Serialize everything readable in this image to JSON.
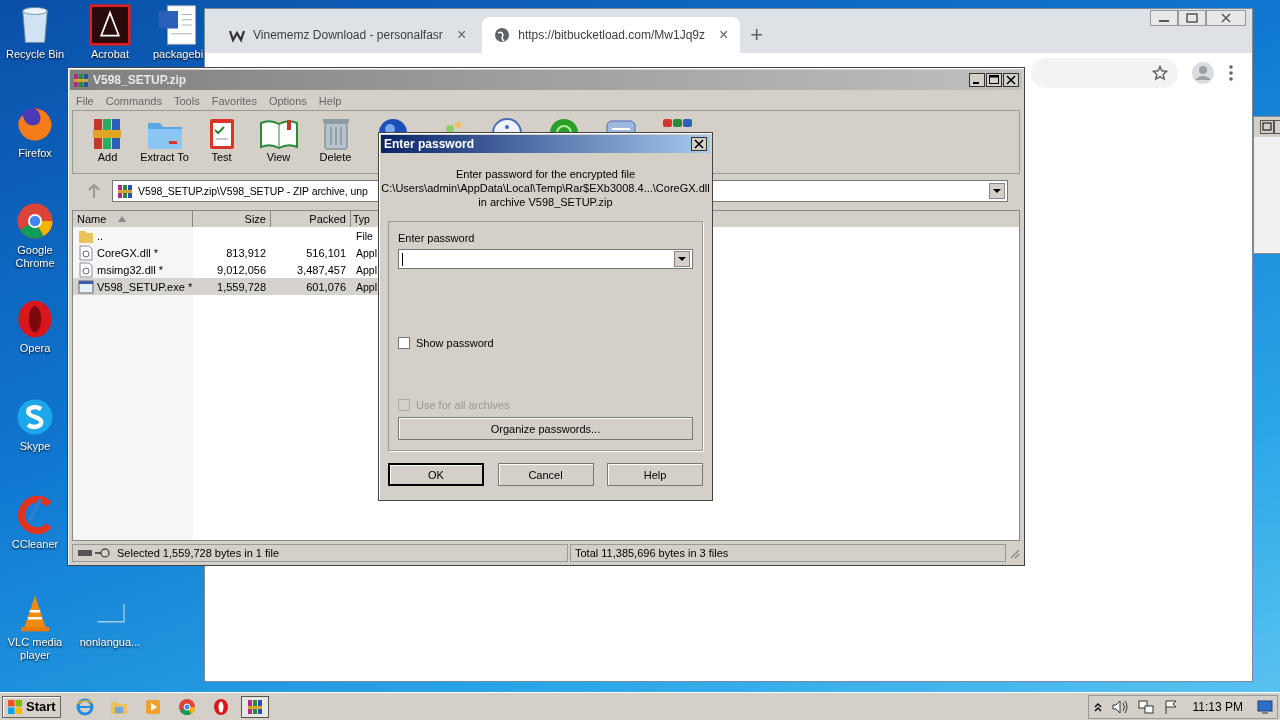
{
  "desktop_icons": [
    {
      "label": "Recycle Bin",
      "kind": "recycle"
    },
    {
      "label": "Acrobat",
      "kind": "acrobat"
    },
    {
      "label": "packagebi",
      "kind": "word"
    },
    {
      "label": "Firefox",
      "kind": "firefox"
    },
    {
      "label": "Google Chrome",
      "kind": "chrome"
    },
    {
      "label": "Opera",
      "kind": "opera"
    },
    {
      "label": "Skype",
      "kind": "skype"
    },
    {
      "label": "CCleaner",
      "kind": "ccleaner"
    },
    {
      "label": "VLC media player",
      "kind": "vlc"
    },
    {
      "label": "nonlangua...",
      "kind": "blank"
    }
  ],
  "browser": {
    "tabs": [
      {
        "title": "Vinememz Download - personalfasr",
        "kind": "site",
        "selected": false
      },
      {
        "title": "https://bitbucketload.com/Mw1Jq9z",
        "kind": "globe",
        "selected": true
      }
    ],
    "close_glyph": "×",
    "new_tab_glyph": "+"
  },
  "winrar": {
    "title": "V598_SETUP.zip",
    "menu": [
      "File",
      "Commands",
      "Tools",
      "Favorites",
      "Options",
      "Help"
    ],
    "toolbar": [
      {
        "label": "Add",
        "kind": "add"
      },
      {
        "label": "Extract To",
        "kind": "extract"
      },
      {
        "label": "Test",
        "kind": "test"
      },
      {
        "label": "View",
        "kind": "view"
      },
      {
        "label": "Delete",
        "kind": "delete"
      },
      {
        "kind": "find"
      },
      {
        "kind": "wizard"
      },
      {
        "kind": "info"
      },
      {
        "kind": "virus"
      },
      {
        "kind": "comment"
      },
      {
        "kind": "sfx"
      }
    ],
    "path": "V598_SETUP.zip\\V598_SETUP - ZIP archive, unp",
    "columns": [
      "Name",
      "Size",
      "Packed",
      "Typ"
    ],
    "rows": [
      {
        "name": "..",
        "size": "",
        "packed": "",
        "type": "File",
        "kind": "folder",
        "selected": false
      },
      {
        "name": "CoreGX.dll *",
        "size": "813,912",
        "packed": "516,101",
        "type": "Appl",
        "kind": "dll",
        "selected": false
      },
      {
        "name": "msimg32.dll *",
        "size": "9,012,056",
        "packed": "3,487,457",
        "type": "Appl",
        "kind": "dll",
        "selected": false
      },
      {
        "name": "V598_SETUP.exe *",
        "size": "1,559,728",
        "packed": "601,076",
        "type": "Appl",
        "kind": "exe",
        "selected": true
      }
    ],
    "status_left": "Selected 1,559,728 bytes in 1 file",
    "status_right": "Total 11,385,696 bytes in 3 files"
  },
  "dialog": {
    "title": "Enter password",
    "message": [
      "Enter password for the encrypted file",
      "C:\\Users\\admin\\AppData\\Local\\Temp\\Rar$EXb3008.4...\\CoreGX.dll",
      "in archive V598_SETUP.zip"
    ],
    "field_label": "Enter password",
    "show_password": {
      "label": "Show password",
      "checked": false,
      "disabled": false
    },
    "use_for_all": {
      "label": "Use for all archives",
      "checked": false,
      "disabled": true
    },
    "organize_button": "Organize passwords...",
    "buttons": [
      {
        "label": "OK",
        "default": true
      },
      {
        "label": "Cancel",
        "default": false
      },
      {
        "label": "Help",
        "default": false
      }
    ]
  },
  "taskbar": {
    "start": "Start",
    "apps": [
      {
        "kind": "ie",
        "active": false
      },
      {
        "kind": "explorer",
        "active": false
      },
      {
        "kind": "media",
        "active": false
      },
      {
        "kind": "chrome",
        "active": false
      },
      {
        "kind": "opera",
        "active": false
      },
      {
        "kind": "winrar",
        "active": true
      }
    ],
    "time": "11:13 PM"
  }
}
